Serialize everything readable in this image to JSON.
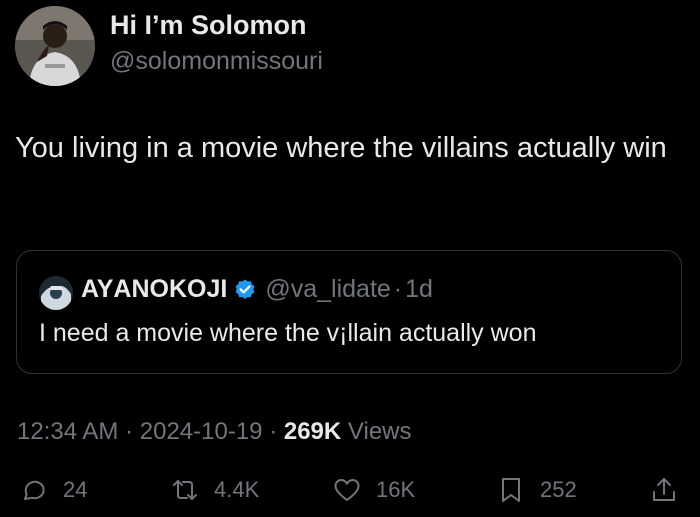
{
  "author": {
    "display_name": "Hi I’m Solomon",
    "handle": "@solomonmissouri",
    "avatar": "profile-photo"
  },
  "tweet": {
    "text": "You living in a movie where the villains actually win"
  },
  "quote": {
    "display_name": "AYΑNOKOJI",
    "verified": true,
    "handle": "@va_lidate",
    "separator": "·",
    "time": "1d",
    "text": "I need a movie where the v¡llain actually won"
  },
  "meta": {
    "time": "12:34 AM",
    "separator": "·",
    "date": "2024-10-19",
    "views_count": "269K",
    "views_label": "Views"
  },
  "actions": {
    "reply_icon": "reply-icon",
    "reply_count": "24",
    "retweet_icon": "retweet-icon",
    "retweet_count": "4.4K",
    "like_icon": "heart-icon",
    "like_count": "16K",
    "bookmark_icon": "bookmark-icon",
    "bookmark_count": "252",
    "share_icon": "share-icon"
  },
  "colors": {
    "background": "#000000",
    "text_primary": "#e7e9ea",
    "text_secondary": "#71767b",
    "border": "#2f3336",
    "verified": "#1d9bf0"
  }
}
